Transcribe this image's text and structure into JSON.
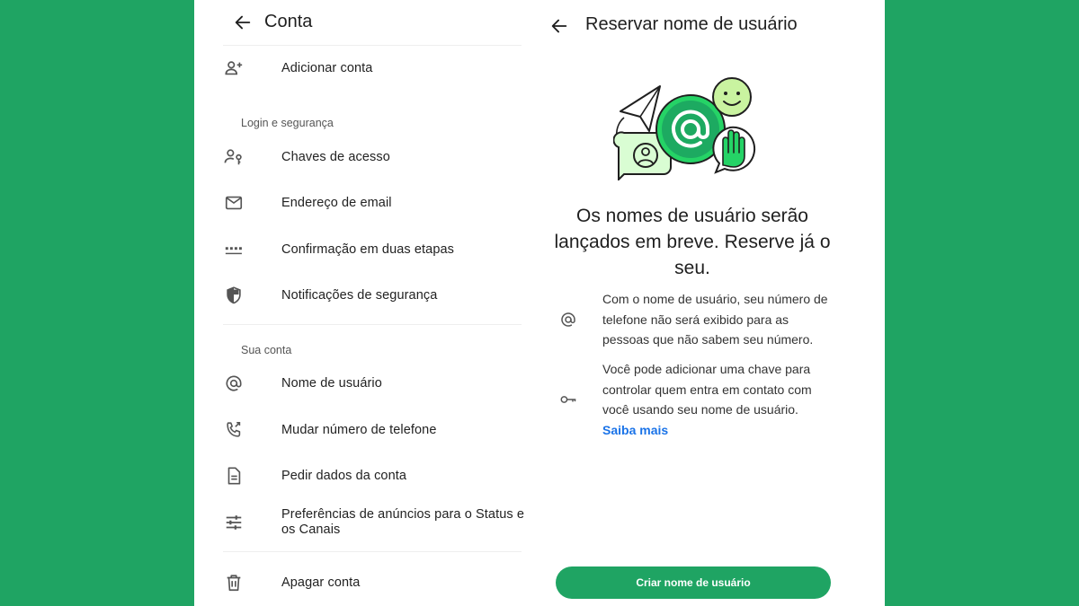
{
  "colors": {
    "brand_green": "#1fa463",
    "link_blue": "#1a73e8",
    "background": "#1fa463"
  },
  "left": {
    "title": "Conta",
    "top_item": {
      "label": "Adicionar conta",
      "icon": "add-person-icon"
    },
    "section_login": "Login e segurança",
    "login_items": [
      {
        "label": "Chaves de acesso",
        "icon": "passkey-icon"
      },
      {
        "label": "Endereço de email",
        "icon": "mail-icon"
      },
      {
        "label": "Confirmação em duas etapas",
        "icon": "dots-icon"
      },
      {
        "label": "Notificações de segurança",
        "icon": "shield-icon"
      }
    ],
    "section_account": "Sua conta",
    "account_items": [
      {
        "label": "Nome de usuário",
        "icon": "at-icon"
      },
      {
        "label": "Mudar número de telefone",
        "icon": "phone-change-icon"
      },
      {
        "label": "Pedir dados da conta",
        "icon": "document-icon"
      },
      {
        "label": "Preferências de anúncios para o Status e os Canais",
        "icon": "sliders-icon"
      }
    ],
    "bottom_item": {
      "label": "Apagar conta",
      "icon": "trash-icon"
    }
  },
  "right": {
    "title": "Reservar nome de usuário",
    "headline": "Os nomes de usuário serão lançados em breve. Reserve já o seu.",
    "info1": "Com o nome de usuário, seu número de telefone não será exibido para as pessoas que não sabem seu número.",
    "info2": "Você pode adicionar uma chave para controlar quem entra em contato com você usando seu nome de usuário.",
    "learn_more": "Saiba mais",
    "cta": "Criar nome de usuário"
  }
}
